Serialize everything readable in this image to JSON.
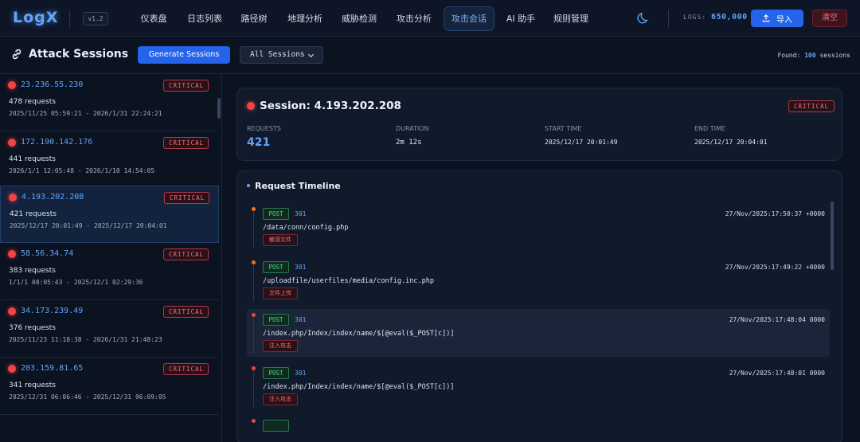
{
  "app": {
    "logo": "LogX",
    "version": "v1.2"
  },
  "nav": [
    {
      "label": "仪表盘",
      "name": "nav-dashboard"
    },
    {
      "label": "日志列表",
      "name": "nav-log-list"
    },
    {
      "label": "路径树",
      "name": "nav-path-tree"
    },
    {
      "label": "地理分析",
      "name": "nav-geo-analysis"
    },
    {
      "label": "威胁检测",
      "name": "nav-threat-detection"
    },
    {
      "label": "攻击分析",
      "name": "nav-attack-analysis"
    },
    {
      "label": "攻击会话",
      "name": "nav-attack-sessions"
    },
    {
      "label": "AI 助手",
      "name": "nav-ai-assistant"
    },
    {
      "label": "规则管理",
      "name": "nav-rule-management"
    }
  ],
  "header": {
    "logs_label": "LOGS:",
    "logs_value": "650,000",
    "import_label": "导入",
    "clear_label": "清空"
  },
  "toolbar": {
    "title": "Attack Sessions",
    "generate_label": "Generate Sessions",
    "filter_value": "All Sessions",
    "found_prefix": "Found:",
    "found_count": "100",
    "found_suffix": "sessions"
  },
  "sessions": [
    {
      "ip": "23.236.55.230",
      "severity": "CRITICAL",
      "requests": "478 requests",
      "range": "2025/11/25 05:59:21 - 2026/1/31 22:24:21"
    },
    {
      "ip": "172.190.142.176",
      "severity": "CRITICAL",
      "requests": "441 requests",
      "range": "2026/1/1 12:05:48 - 2026/1/10 14:54:05"
    },
    {
      "ip": "4.193.202.208",
      "severity": "CRITICAL",
      "requests": "421 requests",
      "range": "2025/12/17 20:01:49 - 2025/12/17 20:04:01"
    },
    {
      "ip": "58.56.34.74",
      "severity": "CRITICAL",
      "requests": "383 requests",
      "range": "1/1/1 08:05:43 - 2025/12/1 02:29:36"
    },
    {
      "ip": "34.173.239.49",
      "severity": "CRITICAL",
      "requests": "376 requests",
      "range": "2025/11/23 11:18:38 - 2026/1/31 21:48:23"
    },
    {
      "ip": "203.159.81.65",
      "severity": "CRITICAL",
      "requests": "341 requests",
      "range": "2025/12/31 06:06:46 - 2025/12/31 06:09:05"
    }
  ],
  "detail": {
    "title": "Session: 4.193.202.208",
    "severity": "CRITICAL",
    "stats": [
      {
        "label": "REQUESTS",
        "value": "421"
      },
      {
        "label": "DURATION",
        "value": "2m 12s"
      },
      {
        "label": "START TIME",
        "value": "2025/12/17 20:01:49"
      },
      {
        "label": "END TIME",
        "value": "2025/12/17 20:04:01"
      }
    ]
  },
  "timeline": {
    "title": "Request Timeline",
    "entries": [
      {
        "method": "POST",
        "status": "301",
        "time": "27/Nov/2025:17:50:37 +0000",
        "path": "/data/conn/config.php",
        "tag": "敏感文件",
        "dot_color": "#f97316"
      },
      {
        "method": "POST",
        "status": "301",
        "time": "27/Nov/2025:17:49:22 +0000",
        "path": "/uploadfile/userfiles/media/config.inc.php",
        "tag": "文件上传",
        "dot_color": "#f97316"
      },
      {
        "method": "POST",
        "status": "301",
        "time": "27/Nov/2025:17:48:04 0000",
        "path": "/index.php/Index/index/name/$[@eval($_POST[c])]",
        "tag": "注入攻击",
        "dot_color": "#ef4444"
      },
      {
        "method": "POST",
        "status": "301",
        "time": "27/Nov/2025:17:48:01 0000",
        "path": "/index.php/Index/index/name/$[@eval($_POST[c])]",
        "tag": "注入攻击",
        "dot_color": "#ef4444"
      }
    ]
  }
}
